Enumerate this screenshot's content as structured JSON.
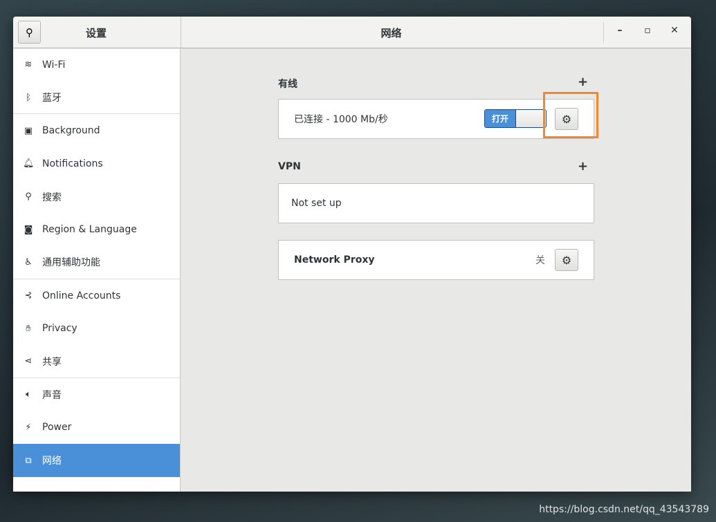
{
  "window": {
    "left_title": "设置",
    "right_title": "网络",
    "minimize": "–",
    "maximize": "▫",
    "close": "✕"
  },
  "sidebar": {
    "items": [
      {
        "label": "Wi-Fi",
        "icon": "wifi-icon",
        "glyph": "≋"
      },
      {
        "label": "蓝牙",
        "icon": "bluetooth-icon",
        "glyph": "ᛒ"
      },
      {
        "label": "Background",
        "icon": "background-icon",
        "glyph": "▣"
      },
      {
        "label": "Notifications",
        "icon": "bell-icon",
        "glyph": "🔔︎"
      },
      {
        "label": "搜索",
        "icon": "search-icon",
        "glyph": "⚲"
      },
      {
        "label": "Region & Language",
        "icon": "region-icon",
        "glyph": "◙"
      },
      {
        "label": "通用辅助功能",
        "icon": "accessibility-icon",
        "glyph": "♿︎"
      },
      {
        "label": "Online Accounts",
        "icon": "online-accounts-icon",
        "glyph": "⊰"
      },
      {
        "label": "Privacy",
        "icon": "privacy-hand-icon",
        "glyph": "✋︎"
      },
      {
        "label": "共享",
        "icon": "share-icon",
        "glyph": "⋖"
      },
      {
        "label": "声音",
        "icon": "speaker-icon",
        "glyph": "🔈︎"
      },
      {
        "label": "Power",
        "icon": "power-icon",
        "glyph": "⚡︎"
      },
      {
        "label": "网络",
        "icon": "network-icon",
        "glyph": "⧉",
        "selected": true
      }
    ]
  },
  "wired": {
    "title": "有线",
    "add": "+",
    "status": "已连接 - 1000 Mb/秒",
    "switch_label": "打开",
    "switch_on": true
  },
  "vpn": {
    "title": "VPN",
    "add": "+",
    "status": "Not set up"
  },
  "proxy": {
    "title": "Network Proxy",
    "status": "关"
  },
  "accent": "#4a90d9",
  "highlight": "#f7862b",
  "watermark": "https://blog.csdn.net/qq_43543789"
}
